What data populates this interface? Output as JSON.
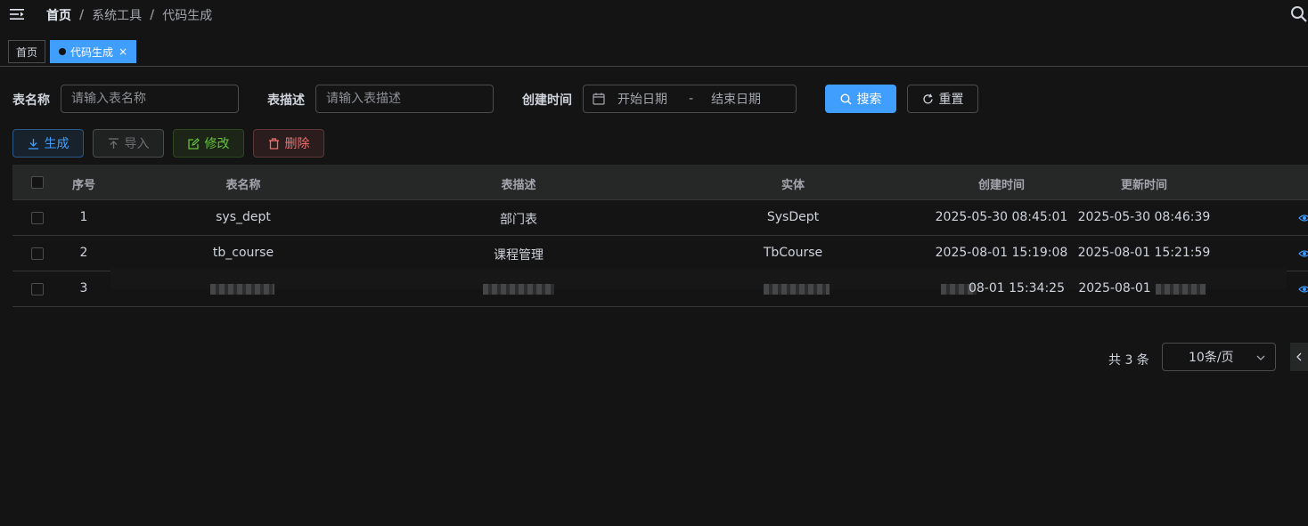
{
  "breadcrumb": [
    "首页",
    "系统工具",
    "代码生成"
  ],
  "breadcrumb_sep": "/",
  "tags": {
    "home": "首页",
    "active": "代码生成",
    "close": "×"
  },
  "search": {
    "table_name_label": "表名称",
    "table_name_placeholder": "请输入表名称",
    "table_desc_label": "表描述",
    "table_desc_placeholder": "请输入表描述",
    "create_time_label": "创建时间",
    "start_date": "开始日期",
    "range_sep": "-",
    "end_date": "结束日期",
    "search_btn": "搜索",
    "reset_btn": "重置"
  },
  "toolbar": {
    "generate": "生成",
    "import": "导入",
    "edit": "修改",
    "delete": "删除"
  },
  "table": {
    "headers": [
      "序号",
      "表名称",
      "表描述",
      "实体",
      "创建时间",
      "更新时间"
    ],
    "rows": [
      {
        "no": "1",
        "name": "sys_dept",
        "desc": "部门表",
        "entity": "SysDept",
        "created": "2025-05-30 08:45:01",
        "updated": "2025-05-30 08:46:39"
      },
      {
        "no": "2",
        "name": "tb_course",
        "desc": "课程管理",
        "entity": "TbCourse",
        "created": "2025-08-01 15:19:08",
        "updated": "2025-08-01 15:21:59"
      },
      {
        "no": "3",
        "name": "",
        "desc": "",
        "entity": "",
        "created": "08-01 15:34:25",
        "updated": "2025-08-01"
      }
    ]
  },
  "pagination": {
    "total": "共 3 条",
    "page_size": "10条/页"
  },
  "colors": {
    "primary": "#409eff",
    "success": "#67c23a",
    "danger": "#f56c6c",
    "bg": "#141414"
  }
}
